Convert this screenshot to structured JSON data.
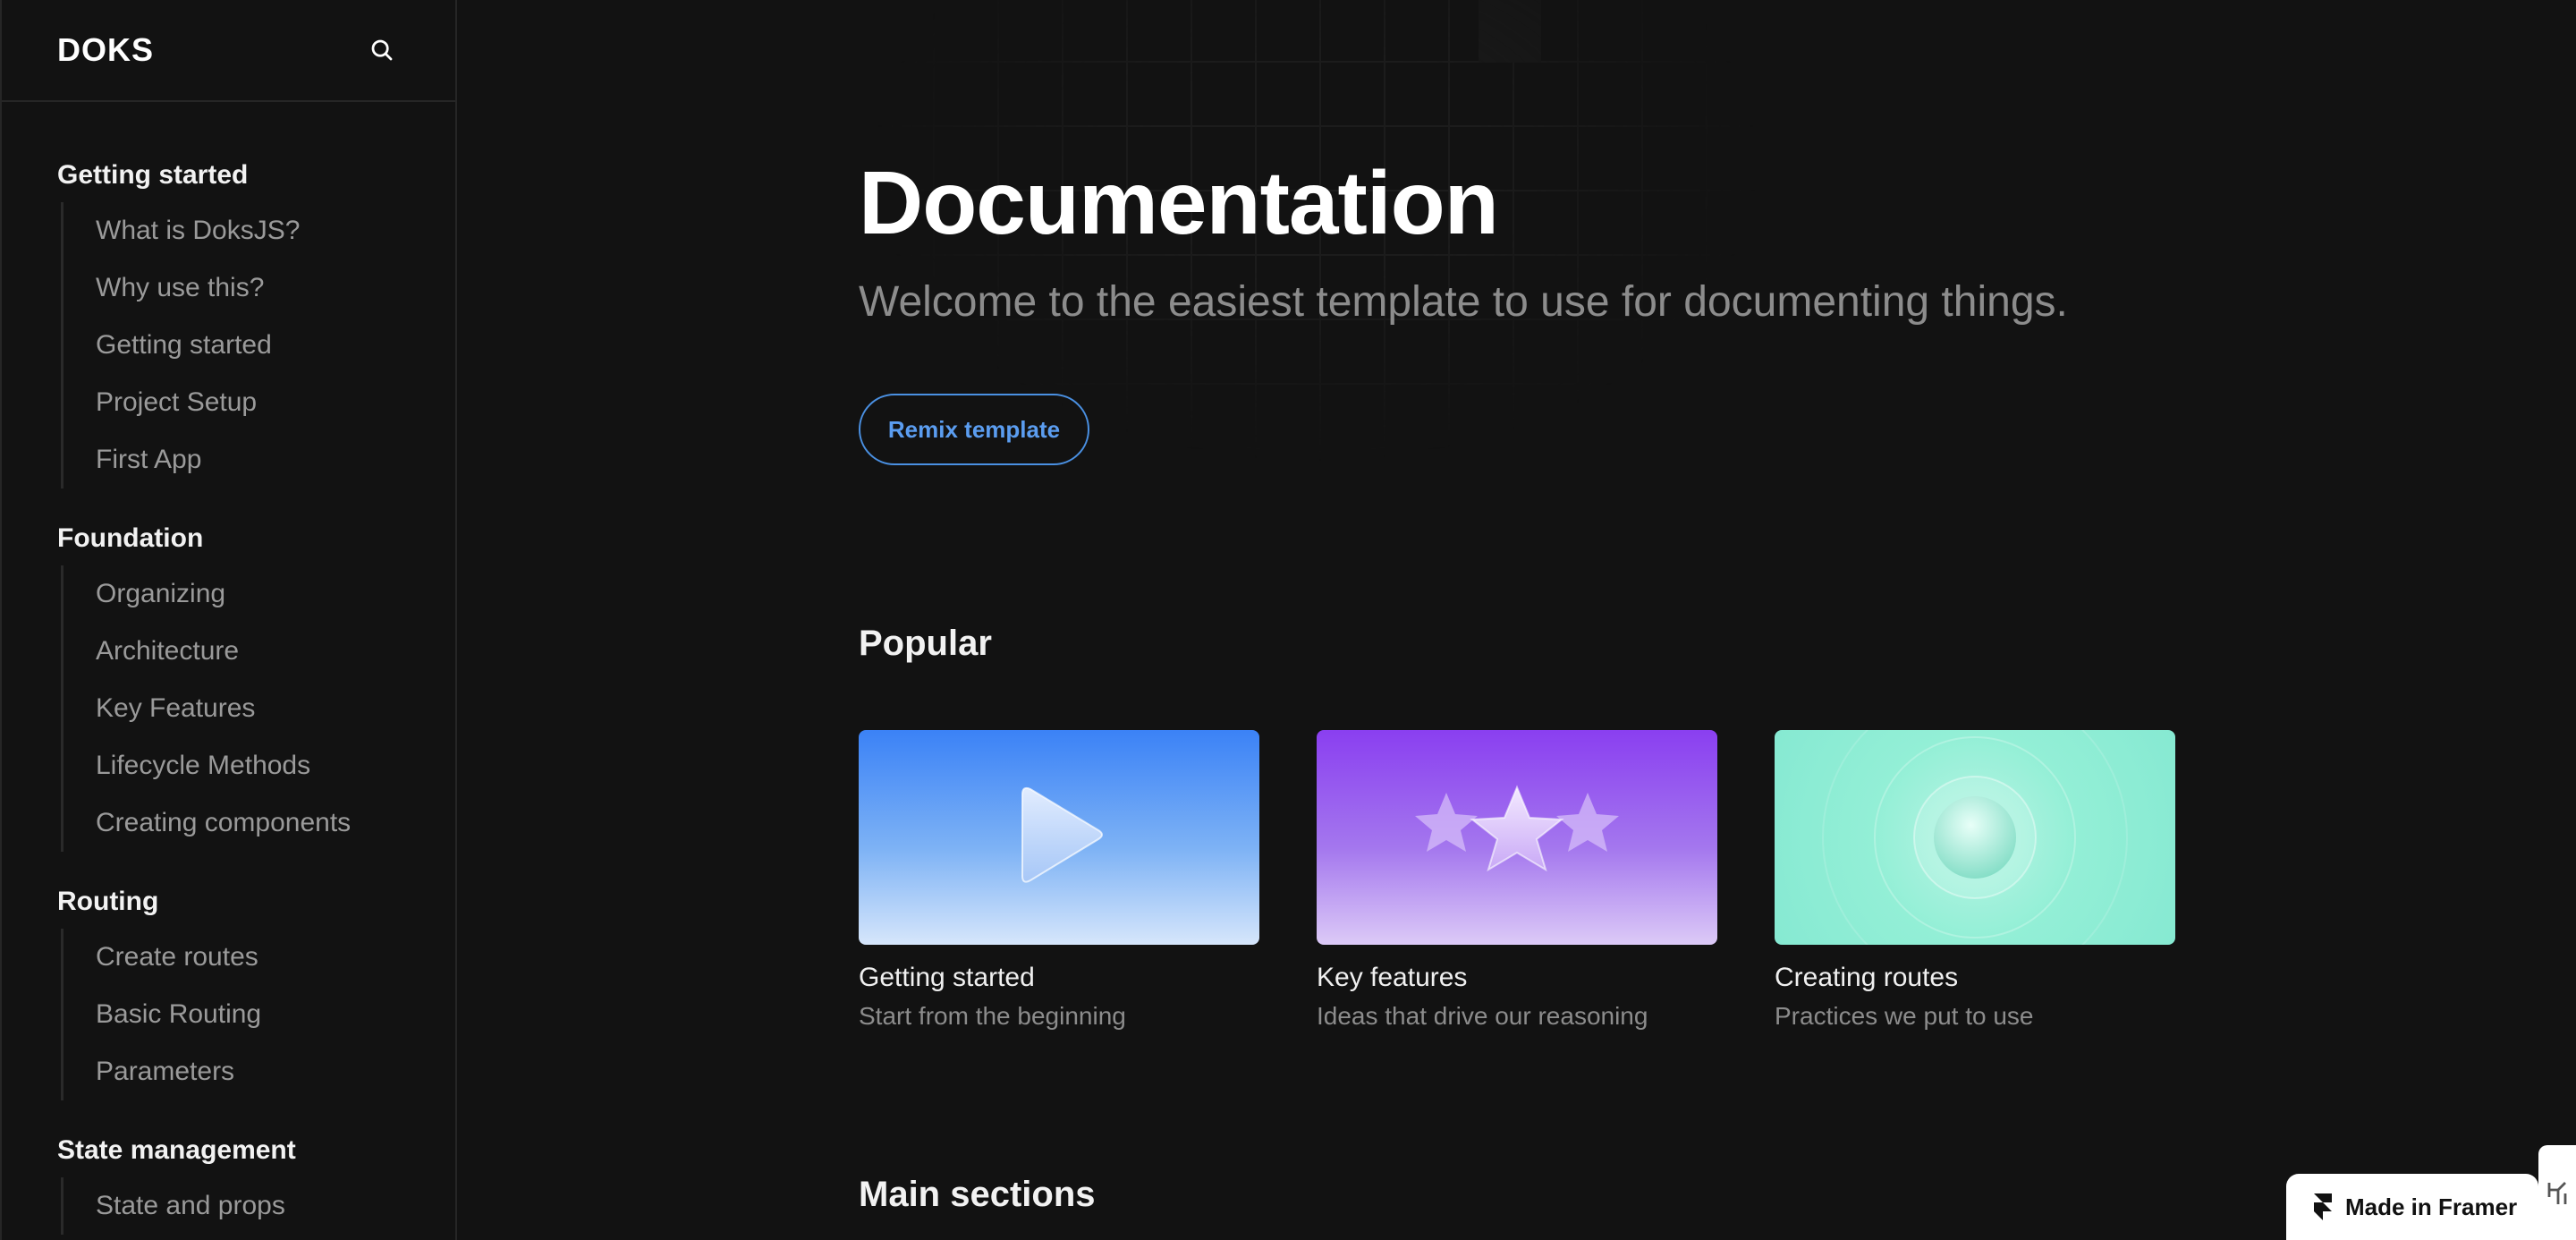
{
  "sidebar": {
    "logo": "DOKS",
    "groups": [
      {
        "title": "Getting started",
        "items": [
          "What is DoksJS?",
          "Why use this?",
          "Getting started",
          "Project Setup",
          "First App"
        ]
      },
      {
        "title": "Foundation",
        "items": [
          "Organizing",
          "Architecture",
          "Key Features",
          "Lifecycle Methods",
          "Creating components"
        ]
      },
      {
        "title": "Routing",
        "items": [
          "Create routes",
          "Basic Routing",
          "Parameters"
        ]
      },
      {
        "title": "State management",
        "items": [
          "State and props"
        ]
      }
    ]
  },
  "hero": {
    "title": "Documentation",
    "subtitle": "Welcome to the easiest template to use for documenting things.",
    "button_label": "Remix template"
  },
  "popular": {
    "title": "Popular",
    "cards": [
      {
        "title": "Getting started",
        "description": "Start from the beginning",
        "icon": "play-icon"
      },
      {
        "title": "Key features",
        "description": "Ideas that drive our reasoning",
        "icon": "star-icon"
      },
      {
        "title": "Creating routes",
        "description": "Practices we put to use",
        "icon": "orb-icon"
      }
    ]
  },
  "main_sections": {
    "title": "Main sections"
  },
  "framer_badge": {
    "label": "Made in Framer"
  },
  "colors": {
    "background": "#121212",
    "accent": "#4a90e2",
    "muted_text": "#9a9a9a"
  }
}
